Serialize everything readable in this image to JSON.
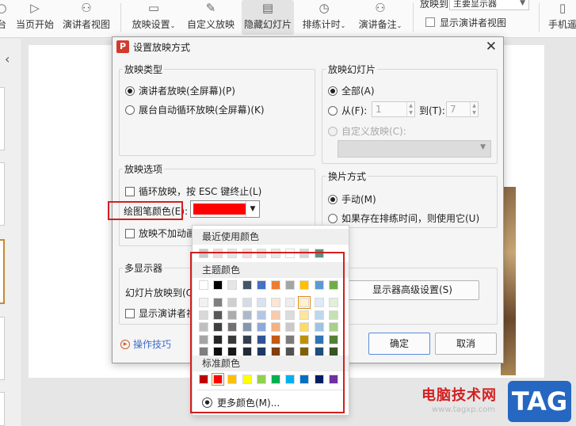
{
  "ribbon": {
    "buttons": [
      {
        "label": "台"
      },
      {
        "label": "当页开始"
      },
      {
        "label": "演讲者视图"
      },
      {
        "label": "放映设置"
      },
      {
        "label": "自定义放映"
      },
      {
        "label": "隐藏幻灯片"
      },
      {
        "label": "排练计时"
      },
      {
        "label": "演讲备注"
      }
    ],
    "monitor_label": "放映到",
    "monitor_value": "主要显示器",
    "presenter_view_check": "显示演讲者视图",
    "phone_remote": "手机遥"
  },
  "dialog": {
    "title": "设置放映方式",
    "app_icon": "P",
    "close": "✕",
    "show_type": {
      "title": "放映类型",
      "options": [
        "演讲者放映(全屏幕)(P)",
        "展台自动循环放映(全屏幕)(K)"
      ],
      "selected": 0
    },
    "show_slides": {
      "title": "放映幻灯片",
      "all": "全部(A)",
      "from": "从(F):",
      "from_value": "1",
      "to": "到(T):",
      "to_value": "7",
      "custom": "自定义放映(C):"
    },
    "show_options": {
      "title": "放映选项",
      "loop": "循环放映，按 ESC 键终止(L)",
      "pen_color": "绘图笔颜色(E):",
      "pen_color_value": "#ff0000",
      "no_animation": "放映不加动画"
    },
    "advance": {
      "title": "换片方式",
      "manual": "手动(M)",
      "timings": "如果存在排练时间，则使用它(U)"
    },
    "multi_monitor": {
      "title": "多显示器",
      "show_on": "幻灯片放映到(O",
      "presenter": "显示演讲者视",
      "advanced_button": "显示器高级设置(S)"
    },
    "tips": "操作技巧",
    "ok": "确定",
    "cancel": "取消"
  },
  "color_picker": {
    "recent_title": "最近使用颜色",
    "recent": [
      "#c8c8c8",
      "#f3d9d9",
      "#e4e4e4",
      "#f4dede",
      "#eadede",
      "#f0e4e4",
      "#ffffff",
      "#d5d5d5",
      "#5b8f7f"
    ],
    "theme_title": "主题颜色",
    "theme_top": [
      "#ffffff",
      "#000000",
      "#e7e6e6",
      "#44546a",
      "#4472c4",
      "#ed7d31",
      "#a5a5a5",
      "#ffc000",
      "#5b9bd5",
      "#70ad47"
    ],
    "theme_shades": [
      [
        "#f2f2f2",
        "#7f7f7f",
        "#d0cece",
        "#d6dce4",
        "#d9e2f3",
        "#fbe5d5",
        "#ededed",
        "#fff2cc",
        "#ddebf7",
        "#e2efd9"
      ],
      [
        "#d8d8d8",
        "#595959",
        "#aeabab",
        "#adb9ca",
        "#b4c6e7",
        "#f7cbac",
        "#dbdbdb",
        "#fee599",
        "#bdd7ee",
        "#c5e0b3"
      ],
      [
        "#bfbfbf",
        "#3f3f3f",
        "#757070",
        "#8496b0",
        "#8eaadb",
        "#f4b183",
        "#c9c9c9",
        "#ffd966",
        "#9cc3e5",
        "#a8d08d"
      ],
      [
        "#a5a5a5",
        "#262626",
        "#3a3838",
        "#323f4f",
        "#2f5496",
        "#c45911",
        "#7b7b7b",
        "#bf9000",
        "#2e75b5",
        "#538135"
      ],
      [
        "#7f7f7f",
        "#0c0c0c",
        "#171616",
        "#222a35",
        "#1f3864",
        "#833c0b",
        "#525252",
        "#7f6000",
        "#1e4e79",
        "#375623"
      ]
    ],
    "standard_title": "标准颜色",
    "standard": [
      "#c00000",
      "#ff0000",
      "#ffc000",
      "#ffff00",
      "#92d050",
      "#00b050",
      "#00b0f0",
      "#0070c0",
      "#002060",
      "#7030a0"
    ],
    "selected_standard": 1,
    "more_colors": "更多颜色(M)..."
  },
  "watermark": {
    "site_name": "电脑技术网",
    "tag": "TAG",
    "url": "www.tagxp.com"
  }
}
